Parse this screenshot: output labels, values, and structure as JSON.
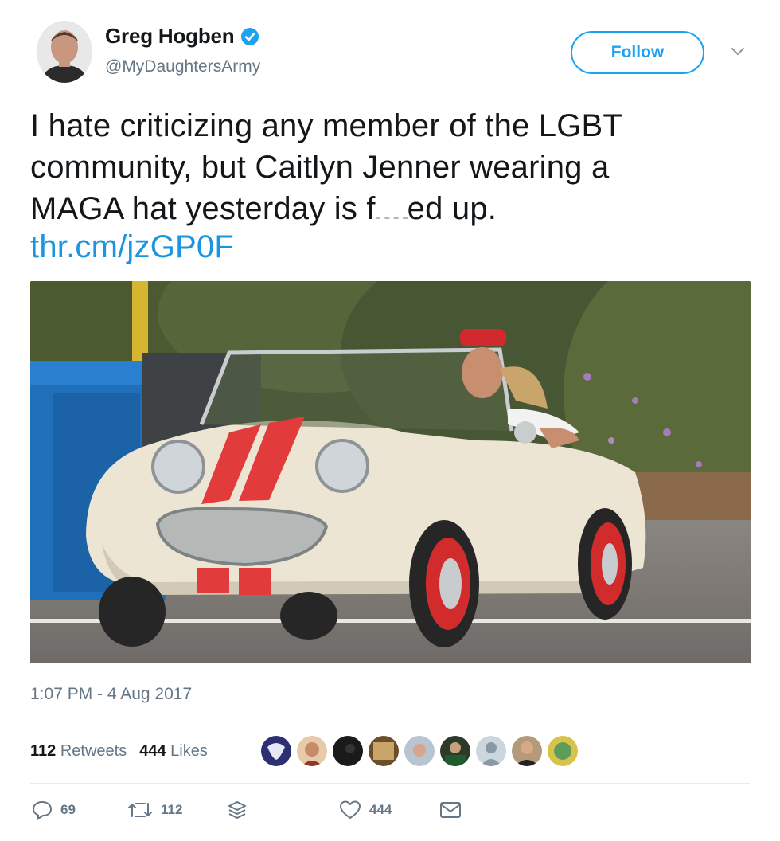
{
  "tweet": {
    "user": {
      "display_name": "Greg Hogben",
      "handle": "@MyDaughtersArmy",
      "verified": true
    },
    "follow_label": "Follow",
    "text_lines": [
      "I hate criticizing any member of the LGBT",
      "community, but Caitlyn Jenner wearing a"
    ],
    "text_line3_start": "MAGA hat yesterday is f",
    "text_line3_end": "ed up.",
    "link": "thr.cm/jzGP0F",
    "timestamp": "1:07 PM - 4 Aug 2017"
  },
  "stats": {
    "retweets_count": "112",
    "retweets_label": "Retweets",
    "likes_count": "444",
    "likes_label": "Likes"
  },
  "actions": {
    "reply_count": "69",
    "retweet_count": "112",
    "like_count": "444"
  },
  "colors": {
    "brand_blue": "#1da1f2",
    "link_blue": "#1b95e0",
    "muted_gray": "#657786"
  },
  "icons": [
    "verified-badge-icon",
    "chevron-down-icon",
    "reply-icon",
    "retweet-icon",
    "stack-icon",
    "heart-icon",
    "mail-icon"
  ]
}
